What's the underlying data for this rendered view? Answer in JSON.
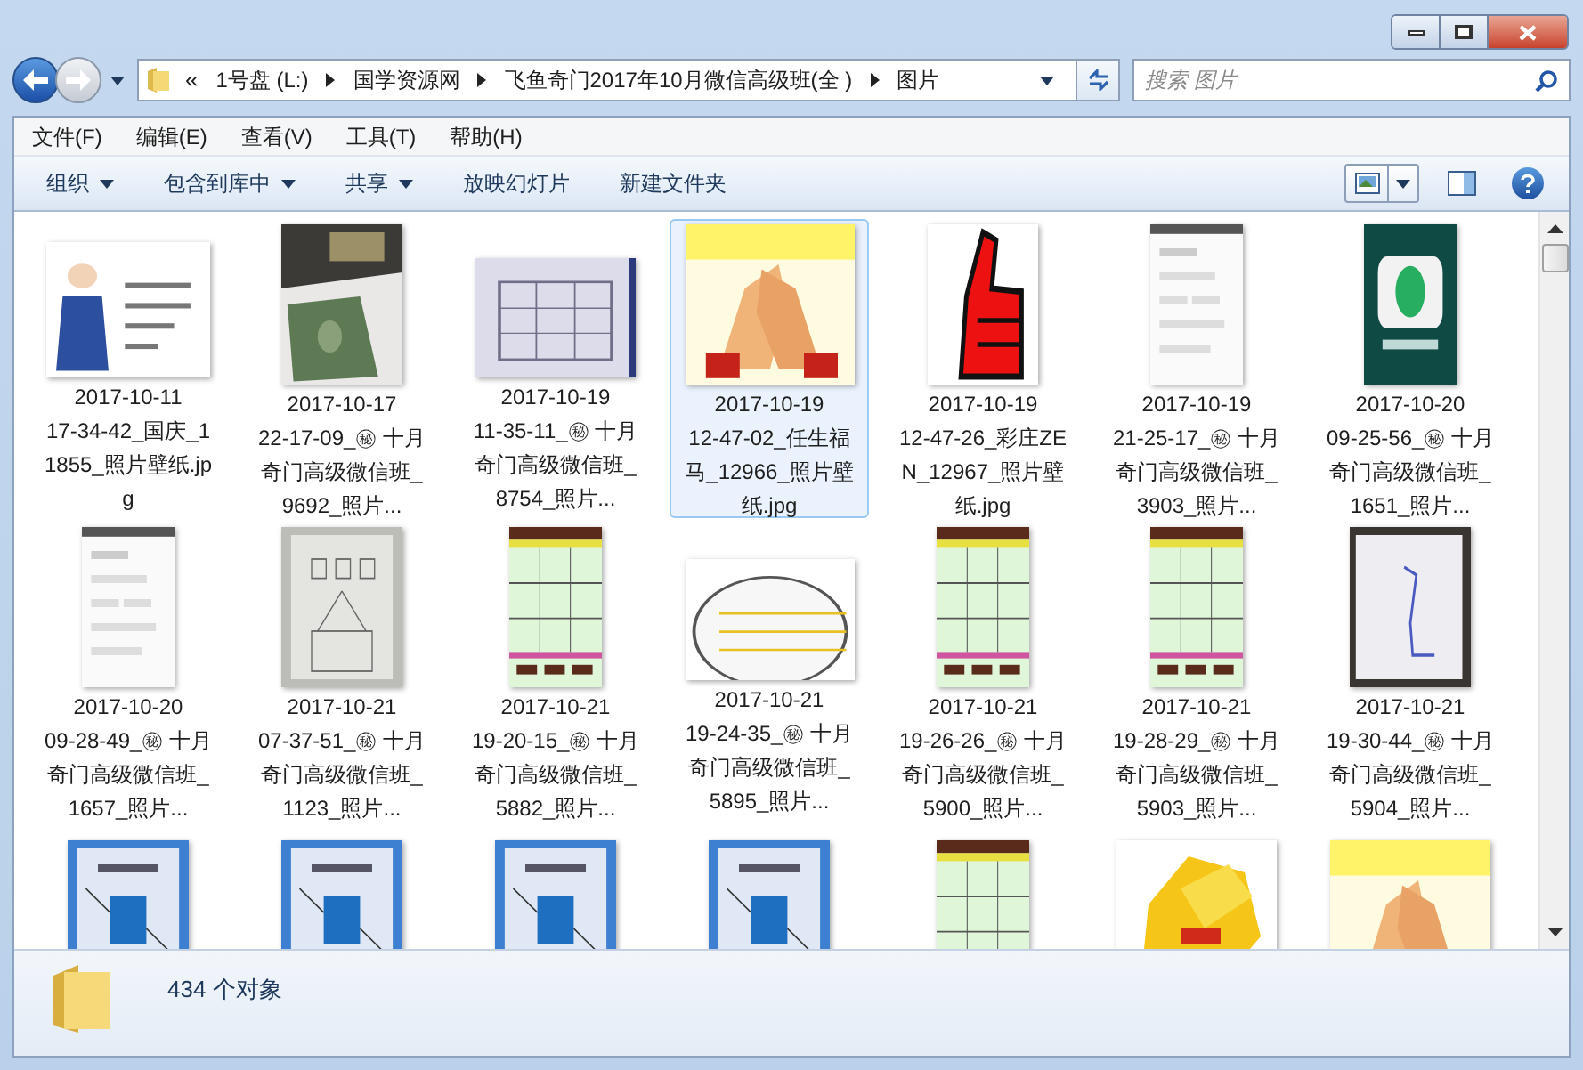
{
  "window": {
    "caption_buttons": [
      {
        "kind": "minimize"
      },
      {
        "kind": "maximize"
      },
      {
        "kind": "close"
      }
    ]
  },
  "address_bar": {
    "overflow": "«",
    "crumbs": [
      "1号盘 (L:)",
      "国学资源网",
      "飞鱼奇门2017年10月微信高级班(全 )",
      "图片"
    ]
  },
  "search": {
    "placeholder": "搜索 图片"
  },
  "menu": [
    "文件(F)",
    "编辑(E)",
    "查看(V)",
    "工具(T)",
    "帮助(H)"
  ],
  "commands": [
    {
      "label": "组织",
      "dropdown": true
    },
    {
      "label": "包含到库中",
      "dropdown": true
    },
    {
      "label": "共享",
      "dropdown": true
    },
    {
      "label": "放映幻灯片",
      "dropdown": false
    },
    {
      "label": "新建文件夹",
      "dropdown": false
    }
  ],
  "files": [
    {
      "kind": "picture",
      "name": "2017-10-11\n17-34-42_国庆_11855_照片壁纸.jpg",
      "selected": false
    },
    {
      "kind": "picture",
      "name": "2017-10-17\n22-17-09_㊙ 十月奇门高级微信班_9692_照片...",
      "selected": false
    },
    {
      "kind": "picture",
      "name": "2017-10-19\n11-35-11_㊙ 十月奇门高级微信班_8754_照片...",
      "selected": false
    },
    {
      "kind": "picture",
      "name": "2017-10-19\n12-47-02_任生福马_12966_照片壁纸.jpg",
      "selected": true
    },
    {
      "kind": "picture",
      "name": "2017-10-19\n12-47-26_彩庄ZEN_12967_照片壁纸.jpg",
      "selected": false
    },
    {
      "kind": "picture",
      "name": "2017-10-19\n21-25-17_㊙ 十月奇门高级微信班_3903_照片...",
      "selected": false
    },
    {
      "kind": "picture",
      "name": "2017-10-20\n09-25-56_㊙ 十月奇门高级微信班_1651_照片...",
      "selected": false
    },
    {
      "kind": "picture",
      "name": "2017-10-20\n09-28-49_㊙ 十月奇门高级微信班_1657_照片...",
      "selected": false
    },
    {
      "kind": "picture",
      "name": "2017-10-21\n07-37-51_㊙ 十月奇门高级微信班_1123_照片...",
      "selected": false
    },
    {
      "kind": "picture",
      "name": "2017-10-21\n19-20-15_㊙ 十月奇门高级微信班_5882_照片...",
      "selected": false
    },
    {
      "kind": "picture",
      "name": "2017-10-21\n19-24-35_㊙ 十月奇门高级微信班_5895_照片...",
      "selected": false
    },
    {
      "kind": "picture",
      "name": "2017-10-21\n19-26-26_㊙ 十月奇门高级微信班_5900_照片...",
      "selected": false
    },
    {
      "kind": "picture",
      "name": "2017-10-21\n19-28-29_㊙ 十月奇门高级微信班_5903_照片...",
      "selected": false
    },
    {
      "kind": "picture",
      "name": "2017-10-21\n19-30-44_㊙ 十月奇门高级微信班_5904_照片...",
      "selected": false
    },
    {
      "kind": "picture",
      "selected": false
    },
    {
      "kind": "picture",
      "selected": false
    },
    {
      "kind": "picture",
      "selected": false
    },
    {
      "kind": "picture",
      "selected": false
    },
    {
      "kind": "picture",
      "selected": false
    },
    {
      "kind": "picture",
      "selected": false
    },
    {
      "kind": "picture",
      "selected": false
    }
  ],
  "status_bar": {
    "count": "434 个对象"
  }
}
